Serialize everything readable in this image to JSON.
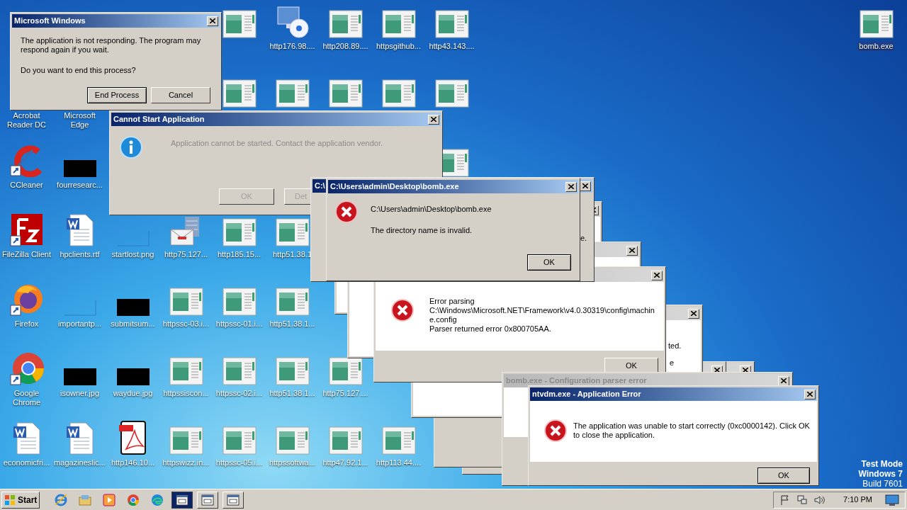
{
  "desktop": {
    "icon_columns": [
      [
        {
          "kind": "covered"
        },
        {
          "kind": "none",
          "label": "Acrobat Reader DC",
          "selected": false
        },
        {
          "kind": "ccleaner",
          "label": "CCleaner",
          "selected": false
        },
        {
          "kind": "filezilla",
          "label": "FileZilla Client",
          "selected": false
        },
        {
          "kind": "firefox",
          "label": "Firefox",
          "selected": false
        },
        {
          "kind": "chrome",
          "label": "Google Chrome",
          "selected": false
        },
        {
          "kind": "word",
          "label": "economicfri...",
          "selected": false
        }
      ],
      [
        {
          "kind": "covered"
        },
        {
          "kind": "none",
          "label": "Microsoft Edge",
          "selected": false
        },
        {
          "kind": "black",
          "label": "fourresearc...",
          "selected": false
        },
        {
          "kind": "word",
          "label": "hpclients.rtf",
          "selected": false
        },
        {
          "kind": "blank",
          "label": "importantp...",
          "selected": false
        },
        {
          "kind": "black",
          "label": "isowner.jpg",
          "selected": false
        },
        {
          "kind": "word",
          "label": "magazineslic...",
          "selected": false
        }
      ],
      [
        {
          "kind": "covered"
        },
        {
          "kind": "covered"
        },
        {
          "kind": "covered"
        },
        {
          "kind": "blank",
          "label": "startlost.png",
          "selected": false
        },
        {
          "kind": "black",
          "label": "submitsum...",
          "selected": false
        },
        {
          "kind": "black",
          "label": "waydue.jpg",
          "selected": false
        },
        {
          "kind": "pdf",
          "label": "http146.10...",
          "selected": false
        }
      ],
      [
        {
          "kind": "covered"
        },
        {
          "kind": "covered"
        },
        {
          "kind": "covered"
        },
        {
          "kind": "email",
          "label": "http75.127...",
          "selected": false
        },
        {
          "kind": "web",
          "label": "httpssc-03.i...",
          "selected": false
        },
        {
          "kind": "web",
          "label": "httpssiscon...",
          "selected": false
        },
        {
          "kind": "web",
          "label": "httpswizz.in...",
          "selected": false
        }
      ],
      [
        {
          "kind": "web"
        },
        {
          "kind": "web"
        },
        {
          "kind": "covered"
        },
        {
          "kind": "web",
          "label": "http185.15...",
          "selected": false
        },
        {
          "kind": "web",
          "label": "httpssc-01.i...",
          "selected": false
        },
        {
          "kind": "web",
          "label": "httpssc-02.i...",
          "selected": false
        },
        {
          "kind": "web",
          "label": "httpssc-05.i...",
          "selected": false
        }
      ],
      [
        {
          "kind": "disc",
          "label": "http176.98....",
          "selected": false
        },
        {
          "kind": "web"
        },
        {
          "kind": "covered"
        },
        {
          "kind": "web",
          "label": "http51.38.1",
          "selected": false
        },
        {
          "kind": "web",
          "label": "http51.38.1...",
          "selected": false
        },
        {
          "kind": "web",
          "label": "http51.38.1...",
          "selected": false
        },
        {
          "kind": "web",
          "label": "httpssoftwa...",
          "selected": false
        }
      ],
      [
        {
          "kind": "web",
          "label": "http208.89....",
          "selected": false
        },
        {
          "kind": "web"
        },
        {
          "kind": "covered"
        },
        {
          "kind": "covered"
        },
        {
          "kind": "covered"
        },
        {
          "kind": "web",
          "label": "http75.127....",
          "selected": false
        },
        {
          "kind": "web",
          "label": "http47.92.1...",
          "selected": false
        }
      ],
      [
        {
          "kind": "web",
          "label": "httpsgithub...",
          "selected": false
        },
        {
          "kind": "web"
        },
        {
          "kind": "covered"
        },
        {
          "kind": "covered"
        },
        {
          "kind": "covered"
        },
        {
          "kind": "covered"
        },
        {
          "kind": "web",
          "label": "http113.44....",
          "selected": false
        }
      ],
      [
        {
          "kind": "web",
          "label": "http43.143....",
          "selected": false
        },
        {
          "kind": "web"
        },
        {
          "kind": "web"
        },
        {
          "kind": "covered"
        },
        {
          "kind": "covered"
        },
        {
          "kind": "covered"
        },
        {
          "kind": "covered"
        }
      ]
    ],
    "corner_icon": {
      "kind": "web",
      "label": "bomb.exe",
      "selected": true
    }
  },
  "windows": {
    "not_responding": {
      "title": "Microsoft Windows",
      "active": true,
      "message": "The application is not responding. The program may respond again if you wait.",
      "question": "Do you want to end this process?",
      "buttons": [
        {
          "label": "End Process",
          "default": true
        },
        {
          "label": "Cancel",
          "default": false
        }
      ]
    },
    "cannot_start": {
      "title": "Cannot Start Application",
      "active": true,
      "message": "Application cannot be started. Contact the application vendor.",
      "buttons": [
        {
          "label": "OK",
          "disabled": true
        },
        {
          "label": "Det",
          "disabled": true
        }
      ]
    },
    "stack_fragments": [
      "ted.",
      "e"
    ],
    "parse_error": {
      "active": false,
      "lines": [
        "Error parsing",
        "C:\\Windows\\Microsoft.NET\\Framework\\v4.0.30319\\config\\machin",
        "e.config",
        "Parser returned error 0x800705AA."
      ],
      "button": "OK"
    },
    "path_error_back": {
      "title": "C:\\",
      "active": true,
      "fragment": "e."
    },
    "path_error": {
      "title": "C:\\Users\\admin\\Desktop\\bomb.exe",
      "active": true,
      "path": "C:\\Users\\admin\\Desktop\\bomb.exe",
      "message": "The directory name is invalid.",
      "button": "OK"
    },
    "config_error": {
      "title": "bomb.exe - Configuration parser error",
      "active": false
    },
    "app_error": {
      "title": "ntvdm.exe - Application Error",
      "active": true,
      "message": "The application was unable to start correctly (0xc0000142). Click OK to close the application.",
      "button": "OK"
    }
  },
  "os_notice": [
    {
      "text": "Test Mode",
      "bold": true
    },
    {
      "text": "Windows 7",
      "bold": true
    },
    {
      "text": "Build 7601",
      "bold": false
    }
  ],
  "taskbar": {
    "start": "Start",
    "items": [
      {
        "kind": "ie",
        "selected": false
      },
      {
        "kind": "folder",
        "selected": false
      },
      {
        "kind": "media",
        "selected": false
      },
      {
        "kind": "chrome",
        "selected": false
      },
      {
        "kind": "edge",
        "selected": false
      },
      {
        "kind": "window",
        "selected": true
      },
      {
        "kind": "window",
        "selected": false
      },
      {
        "kind": "window",
        "selected": false
      }
    ],
    "clock": "7:10 PM"
  }
}
